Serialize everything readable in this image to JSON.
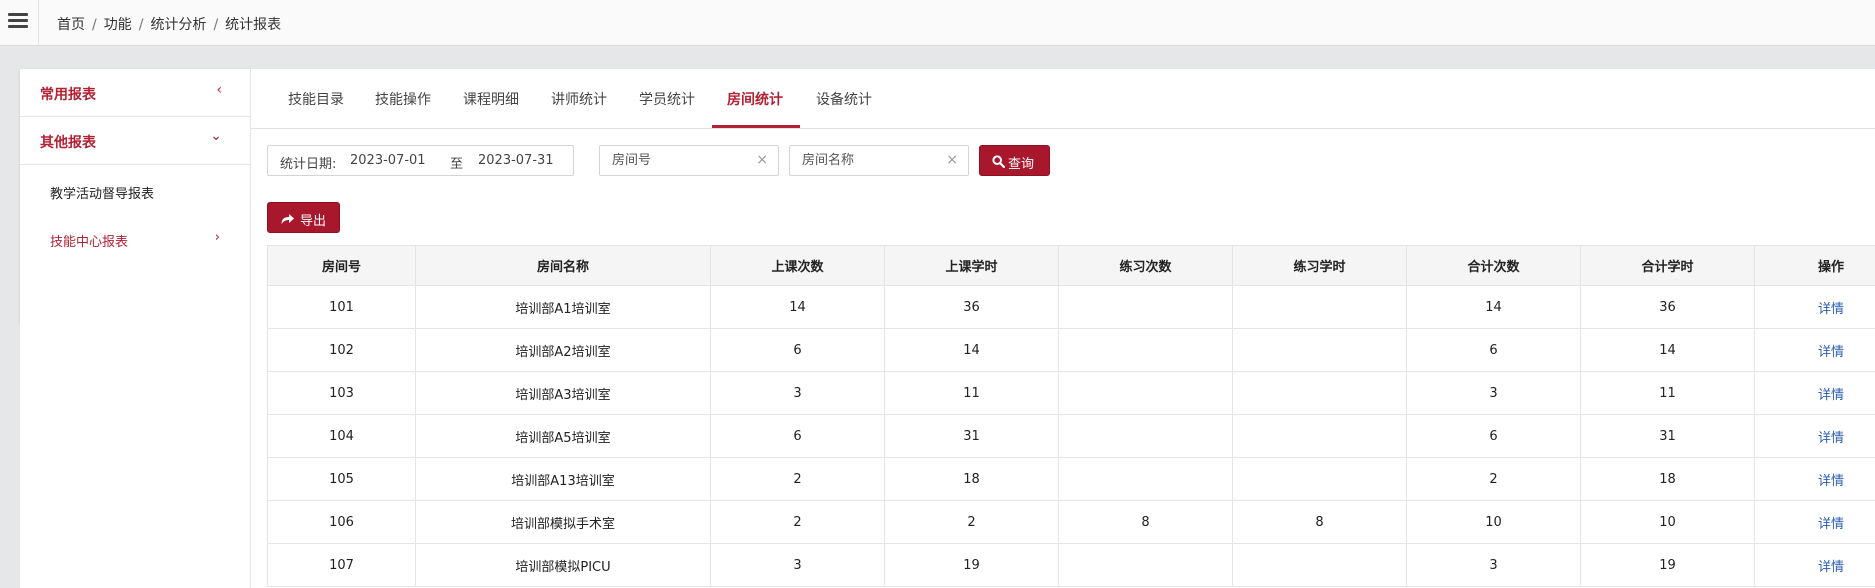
{
  "breadcrumb": [
    "首页",
    "功能",
    "统计分析",
    "统计报表"
  ],
  "sidebar": {
    "groups": [
      {
        "title": "常用报表",
        "chevron": "‹"
      },
      {
        "title": "其他报表",
        "chevron": "⌄"
      }
    ],
    "items": [
      {
        "label": "教学活动督导报表"
      },
      {
        "label": "技能中心报表",
        "chevron": "›"
      }
    ]
  },
  "tabs": [
    "技能目录",
    "技能操作",
    "课程明细",
    "讲师统计",
    "学员统计",
    "房间统计",
    "设备统计"
  ],
  "active_tab": "房间统计",
  "filters": {
    "date_label": "统计日期:",
    "date_start": "2023-07-01",
    "date_to": "至",
    "date_end": "2023-07-31",
    "room_no_placeholder": "房间号",
    "room_name_placeholder": "房间名称",
    "clear_icon": "×",
    "search_label": "查询",
    "search_icon": "search-icon"
  },
  "export": {
    "label": "导出",
    "icon": "share-icon"
  },
  "table": {
    "headers": [
      "房间号",
      "房间名称",
      "上课次数",
      "上课学时",
      "练习次数",
      "练习学时",
      "合计次数",
      "合计学时",
      "操作"
    ],
    "rows": [
      [
        "101",
        "培训部A1培训室",
        "14",
        "36",
        "",
        "",
        "14",
        "36",
        "详情"
      ],
      [
        "102",
        "培训部A2培训室",
        "6",
        "14",
        "",
        "",
        "6",
        "14",
        "详情"
      ],
      [
        "103",
        "培训部A3培训室",
        "3",
        "11",
        "",
        "",
        "3",
        "11",
        "详情"
      ],
      [
        "104",
        "培训部A5培训室",
        "6",
        "31",
        "",
        "",
        "6",
        "31",
        "详情"
      ],
      [
        "105",
        "培训部A13培训室",
        "2",
        "18",
        "",
        "",
        "2",
        "18",
        "详情"
      ],
      [
        "106",
        "培训部模拟手术室",
        "2",
        "2",
        "8",
        "8",
        "10",
        "10",
        "详情"
      ],
      [
        "107",
        "培训部模拟PICU",
        "3",
        "19",
        "",
        "",
        "3",
        "19",
        "详情"
      ]
    ]
  },
  "colors": {
    "accent": "#a8172c",
    "link": "#2a5db0"
  }
}
